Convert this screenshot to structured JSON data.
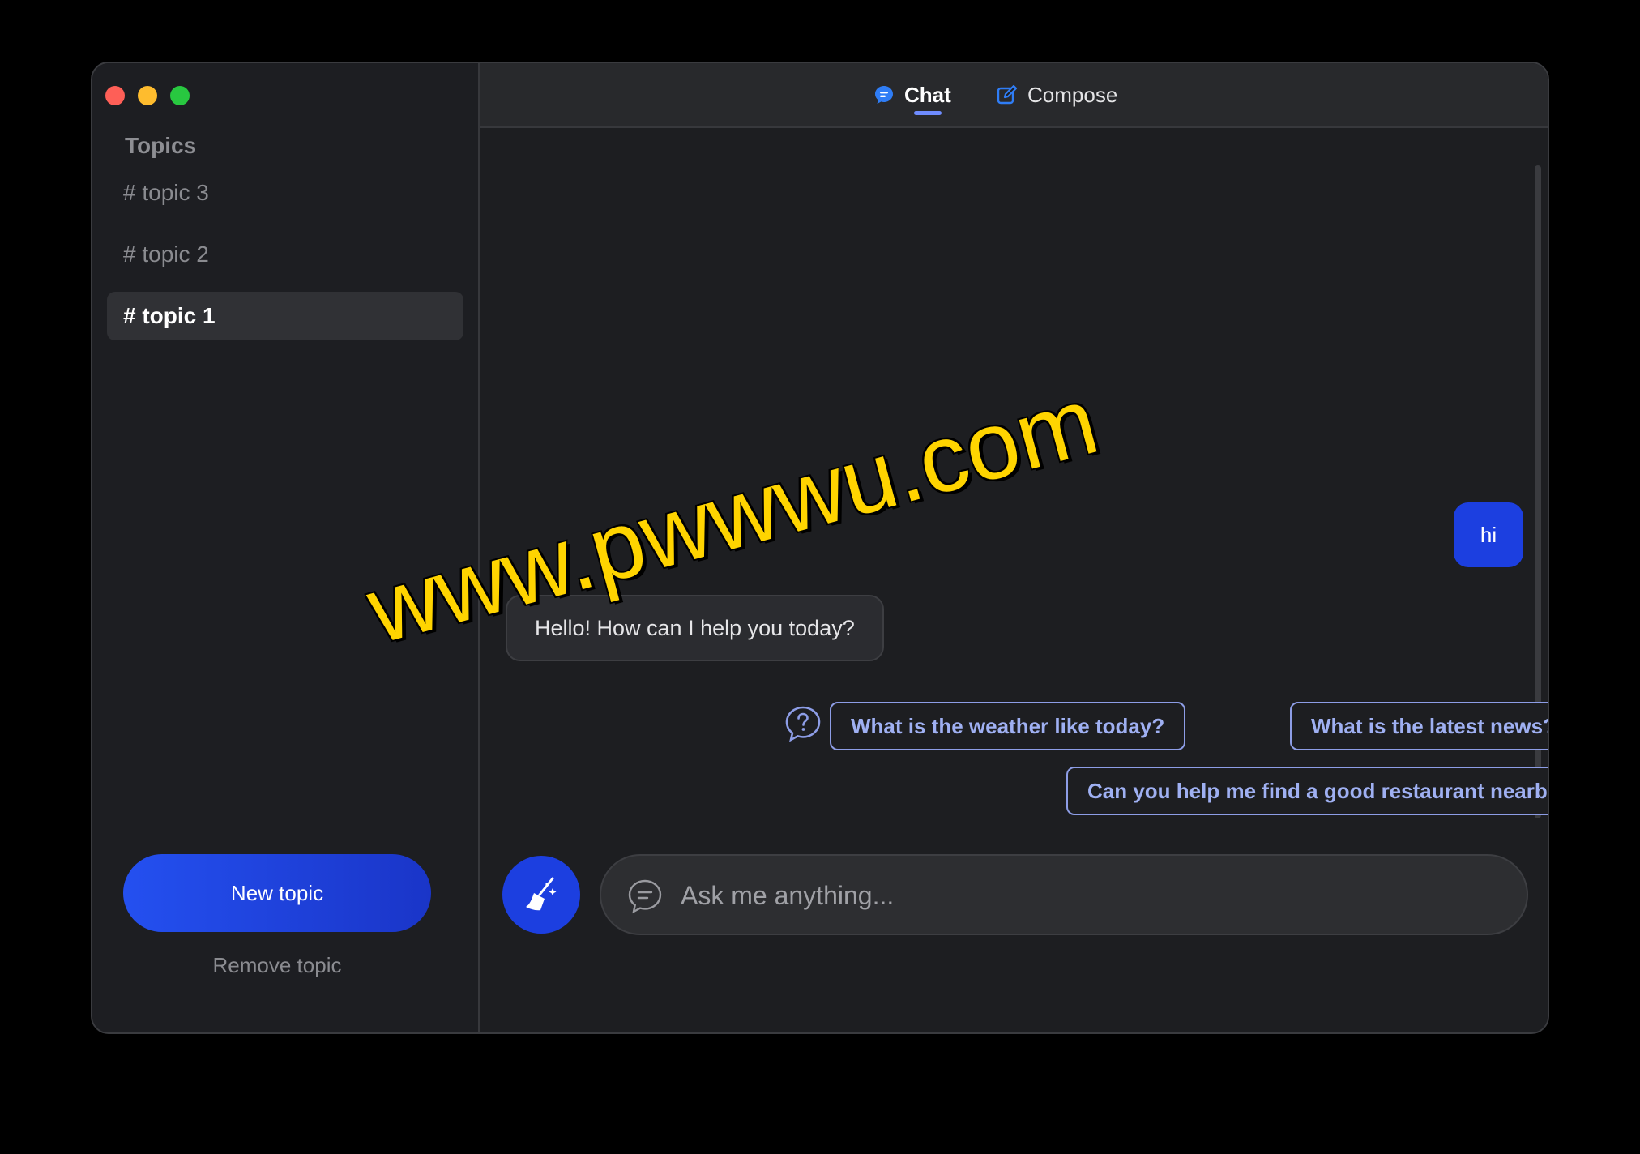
{
  "sidebar": {
    "title": "Topics",
    "topics": [
      {
        "label": "# topic 3",
        "active": false
      },
      {
        "label": "# topic 2",
        "active": false
      },
      {
        "label": "# topic 1",
        "active": true
      }
    ],
    "new_topic_label": "New topic",
    "remove_topic_label": "Remove topic"
  },
  "header": {
    "tabs": [
      {
        "label": "Chat",
        "icon": "chat-bubble-icon",
        "active": true
      },
      {
        "label": "Compose",
        "icon": "edit-icon",
        "active": false
      }
    ]
  },
  "messages": [
    {
      "role": "user",
      "text": "hi"
    },
    {
      "role": "assistant",
      "text": "Hello! How can I help you today?"
    }
  ],
  "suggestions": {
    "icon": "question-icon",
    "items": [
      "What is the weather like today?",
      "What is the latest news?",
      "Can you help me find a good restaurant nearby?"
    ]
  },
  "input": {
    "placeholder": "Ask me anything...",
    "value": "",
    "clear_icon": "broom-icon",
    "input_icon": "chat-icon"
  },
  "watermark": "www.pwwwu.com",
  "colors": {
    "accent": "#1c3fe0",
    "chip_border": "#8d9de6",
    "background": "#1d1e21"
  }
}
